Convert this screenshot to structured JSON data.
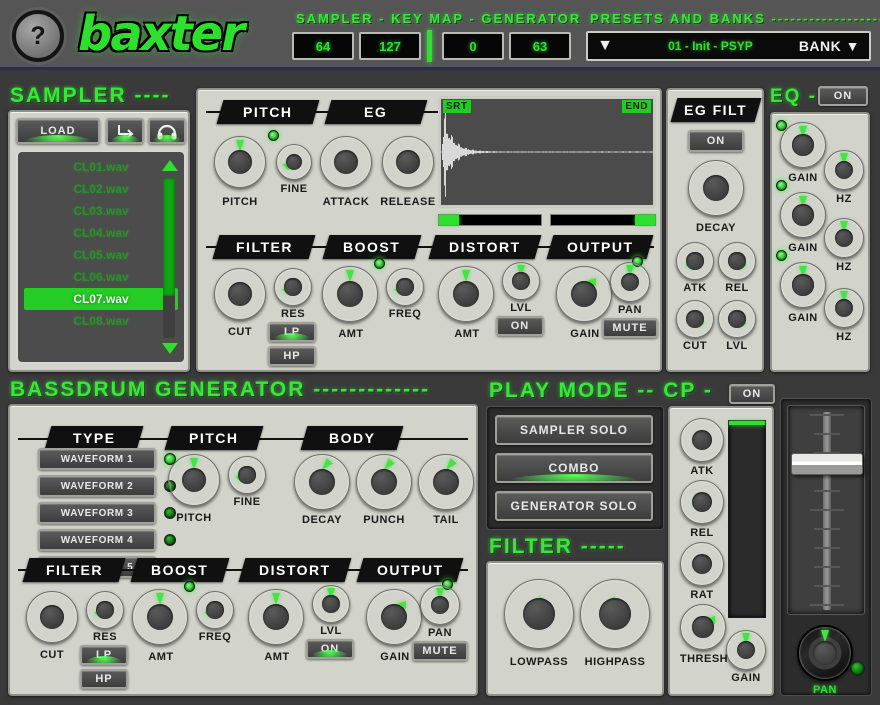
{
  "app": {
    "title": "baxter",
    "help": "?"
  },
  "header": {
    "keymap_label": "SAMPLER -  KEY MAP - GENERATOR",
    "values": [
      {
        "name": "sampler_low",
        "value": "64"
      },
      {
        "name": "sampler_high",
        "value": "127"
      },
      {
        "name": "generator_low",
        "value": "0"
      },
      {
        "name": "generator_high",
        "value": "63"
      }
    ],
    "presets_label": "PRESETS AND BANKS --------------------",
    "preset_prev": "▼",
    "preset_name": "01 - Init - PSYP",
    "bank_label": "BANK ▼"
  },
  "sampler": {
    "title": "SAMPLER ----",
    "load_label": "LOAD",
    "loop_icon": "loop-icon",
    "preview_icon": "headphones-icon",
    "files": [
      "CL01.wav",
      "CL02.wav",
      "CL03.wav",
      "CL04.wav",
      "CL05.wav",
      "CL06.wav",
      "CL07.wav",
      "CL08.wav"
    ],
    "selected_file": "CL07.wav",
    "pitch": {
      "banner": "PITCH",
      "knobs": [
        {
          "label": "PITCH",
          "angle": 0
        },
        {
          "label": "FINE",
          "angle": -135
        }
      ],
      "led": true
    },
    "eg": {
      "banner": "EG",
      "knobs": [
        {
          "label": "ATTACK",
          "angle": -145
        },
        {
          "label": "RELEASE",
          "angle": 145
        }
      ]
    },
    "wave": {
      "start_tag": "SRT",
      "end_tag": "END"
    },
    "eg_filt": {
      "banner": "EG FILT",
      "on_label": "ON",
      "knobs": [
        {
          "label": "DECAY",
          "angle": 150
        },
        {
          "label": "ATK",
          "angle": -150
        },
        {
          "label": "REL",
          "angle": 150
        },
        {
          "label": "CUT",
          "angle": 150
        },
        {
          "label": "LVL",
          "angle": 150
        }
      ]
    },
    "filter": {
      "banner": "FILTER",
      "knobs": [
        {
          "label": "CUT",
          "angle": 140
        },
        {
          "label": "RES",
          "angle": -140
        }
      ],
      "lp_label": "LP",
      "hp_label": "HP",
      "lp_active": true
    },
    "boost": {
      "banner": "BOOST",
      "knobs": [
        {
          "label": "AMT",
          "angle": 0
        },
        {
          "label": "FREQ",
          "angle": -140
        }
      ],
      "led": true
    },
    "distort": {
      "banner": "DISTORT",
      "knobs": [
        {
          "label": "AMT",
          "angle": 0
        },
        {
          "label": "LVL",
          "angle": 0
        }
      ],
      "on_label": "ON"
    },
    "output": {
      "banner": "OUTPUT",
      "knobs": [
        {
          "label": "GAIN",
          "angle": 90
        },
        {
          "label": "PAN",
          "angle": 0
        }
      ],
      "mute_label": "MUTE",
      "led": true
    }
  },
  "eq": {
    "title": "EQ -",
    "on_label": "ON",
    "bands": [
      {
        "gain_label": "GAIN",
        "gain_angle": 0,
        "hz_label": "HZ",
        "hz_angle": 0,
        "led": true
      },
      {
        "gain_label": "GAIN",
        "gain_angle": 0,
        "hz_label": "HZ",
        "hz_angle": 0,
        "led": true
      },
      {
        "gain_label": "GAIN",
        "gain_angle": 0,
        "hz_label": "HZ",
        "hz_angle": 0,
        "led": true
      }
    ]
  },
  "generator": {
    "title": "BASSDRUM GENERATOR -------------",
    "type": {
      "banner": "TYPE",
      "waveforms": [
        {
          "label": "WAVEFORM 1",
          "on": true
        },
        {
          "label": "WAVEFORM 2",
          "on": false
        },
        {
          "label": "WAVEFORM 3",
          "on": false
        },
        {
          "label": "WAVEFORM 4",
          "on": false
        },
        {
          "label": "WAVEFORM 5",
          "on": false
        }
      ]
    },
    "pitch": {
      "banner": "PITCH",
      "knobs": [
        {
          "label": "PITCH",
          "angle": 0
        },
        {
          "label": "FINE",
          "angle": -135
        }
      ]
    },
    "body": {
      "banner": "BODY",
      "knobs": [
        {
          "label": "DECAY",
          "angle": 40
        },
        {
          "label": "PUNCH",
          "angle": 40
        },
        {
          "label": "TAIL",
          "angle": 40
        }
      ]
    },
    "filter": {
      "banner": "FILTER",
      "knobs": [
        {
          "label": "CUT",
          "angle": 140
        },
        {
          "label": "RES",
          "angle": -140
        }
      ],
      "lp_label": "LP",
      "hp_label": "HP",
      "lp_active": true
    },
    "boost": {
      "banner": "BOOST",
      "knobs": [
        {
          "label": "AMT",
          "angle": 0
        },
        {
          "label": "FREQ",
          "angle": -140
        }
      ],
      "led": true
    },
    "distort": {
      "banner": "DISTORT",
      "knobs": [
        {
          "label": "AMT",
          "angle": 0
        },
        {
          "label": "LVL",
          "angle": 0
        }
      ],
      "on_label": "ON"
    },
    "output": {
      "banner": "OUTPUT",
      "knobs": [
        {
          "label": "GAIN",
          "angle": 90
        },
        {
          "label": "PAN",
          "angle": 0
        }
      ],
      "mute_label": "MUTE",
      "led": true
    }
  },
  "play_mode": {
    "title": "PLAY MODE -- CP -",
    "cp_on_label": "ON",
    "modes": [
      {
        "label": "SAMPLER SOLO",
        "active": false
      },
      {
        "label": "COMBO",
        "active": true
      },
      {
        "label": "GENERATOR SOLO",
        "active": false
      }
    ]
  },
  "master_filter": {
    "title": "FILTER -----",
    "knobs": [
      {
        "label": "LOWPASS",
        "angle": 150
      },
      {
        "label": "HIGHPASS",
        "angle": -150
      }
    ]
  },
  "compressor": {
    "knobs": [
      {
        "label": "ATK",
        "angle": -150
      },
      {
        "label": "REL",
        "angle": -150
      },
      {
        "label": "RAT",
        "angle": -150
      },
      {
        "label": "THRESH",
        "angle": 90
      },
      {
        "label": "GAIN",
        "angle": 0
      }
    ]
  },
  "master": {
    "fader_position_pct": 28,
    "pan_label": "PAN",
    "pan_angle": 0,
    "led": false
  },
  "colors": {
    "accent_green": "#2ee02e",
    "panel": "#d2d4cb",
    "background": "#3a3a3a",
    "banner": "#101010"
  }
}
